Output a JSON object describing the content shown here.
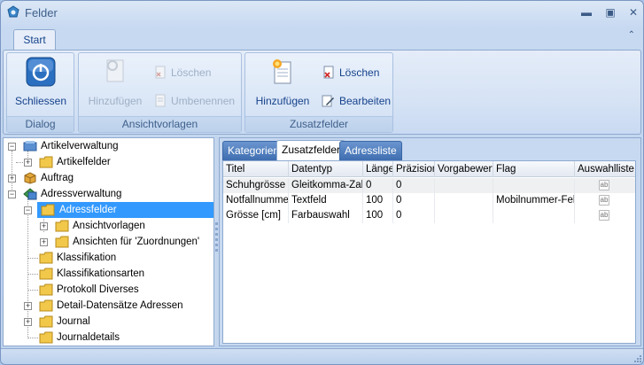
{
  "window": {
    "title": "Felder",
    "controls": {
      "minimize": "▬",
      "maximize": "▣",
      "close": "✕"
    }
  },
  "ribbon": {
    "tabs": [
      {
        "label": "Start",
        "active": true
      }
    ],
    "collapse_glyph": "⌃",
    "groups": {
      "dialog": {
        "label": "Dialog",
        "close_label": "Schliessen",
        "close_icon": "power-icon"
      },
      "ansichtvorlagen": {
        "label": "Ansichtvorlagen",
        "add_label": "Hinzufügen",
        "delete_label": "Löschen",
        "rename_label": "Umbenennen",
        "enabled": false
      },
      "zusatzfelder": {
        "label": "Zusatzfelder",
        "add_label": "Hinzufügen",
        "delete_label": "Löschen",
        "edit_label": "Bearbeiten"
      }
    }
  },
  "tree": {
    "items": [
      {
        "label": "Artikelverwaltung",
        "expander": "−",
        "icon": "module-icon"
      },
      {
        "label": "Artikelfelder",
        "expander": "+",
        "icon": "folder-icon"
      },
      {
        "label": "Auftrag",
        "expander": "+",
        "icon": "box-icon"
      },
      {
        "label": "Adressverwaltung",
        "expander": "−",
        "icon": "address-icon"
      },
      {
        "label": "Adressfelder",
        "expander": "−",
        "icon": "folder-icon",
        "selected": true
      },
      {
        "label": "Ansichtvorlagen",
        "expander": "+",
        "icon": "folder-icon"
      },
      {
        "label": "Ansichten für 'Zuordnungen'",
        "expander": "+",
        "icon": "folder-icon"
      },
      {
        "label": "Klassifikation",
        "expander": "",
        "icon": "folder-icon"
      },
      {
        "label": "Klassifikationsarten",
        "expander": "",
        "icon": "folder-icon"
      },
      {
        "label": "Protokoll Diverses",
        "expander": "",
        "icon": "folder-icon"
      },
      {
        "label": "Detail-Datensätze Adressen",
        "expander": "+",
        "icon": "folder-icon"
      },
      {
        "label": "Journal",
        "expander": "+",
        "icon": "folder-icon"
      },
      {
        "label": "Journaldetails",
        "expander": "",
        "icon": "folder-icon"
      }
    ]
  },
  "right": {
    "tabs": [
      {
        "label": "Kategorien",
        "active": false
      },
      {
        "label": "Zusatzfelder",
        "active": true
      },
      {
        "label": "Adressliste",
        "active": false
      }
    ],
    "columns": [
      "Titel",
      "Datentyp",
      "Länge",
      "Präzision",
      "Vorgabewert",
      "Flag",
      "Auswahlliste"
    ],
    "rows": [
      {
        "titel": "Schuhgrösse",
        "datentyp": "Gleitkomma-Zahl",
        "laenge": "0",
        "praezision": "0",
        "vorgabewert": "",
        "flag": "",
        "auswahl_icon": "ab"
      },
      {
        "titel": "Notfallnummer",
        "datentyp": "Textfeld",
        "laenge": "100",
        "praezision": "0",
        "vorgabewert": "",
        "flag": "Mobilnummer-Feld",
        "auswahl_icon": "ab"
      },
      {
        "titel": "Grösse [cm]",
        "datentyp": "Farbauswahl",
        "laenge": "100",
        "praezision": "0",
        "vorgabewert": "",
        "flag": "",
        "auswahl_icon": "ab"
      }
    ]
  },
  "colors": {
    "selection": "#3399ff",
    "tab_inactive": "#4a78b8",
    "ribbon_text": "#15428b"
  }
}
